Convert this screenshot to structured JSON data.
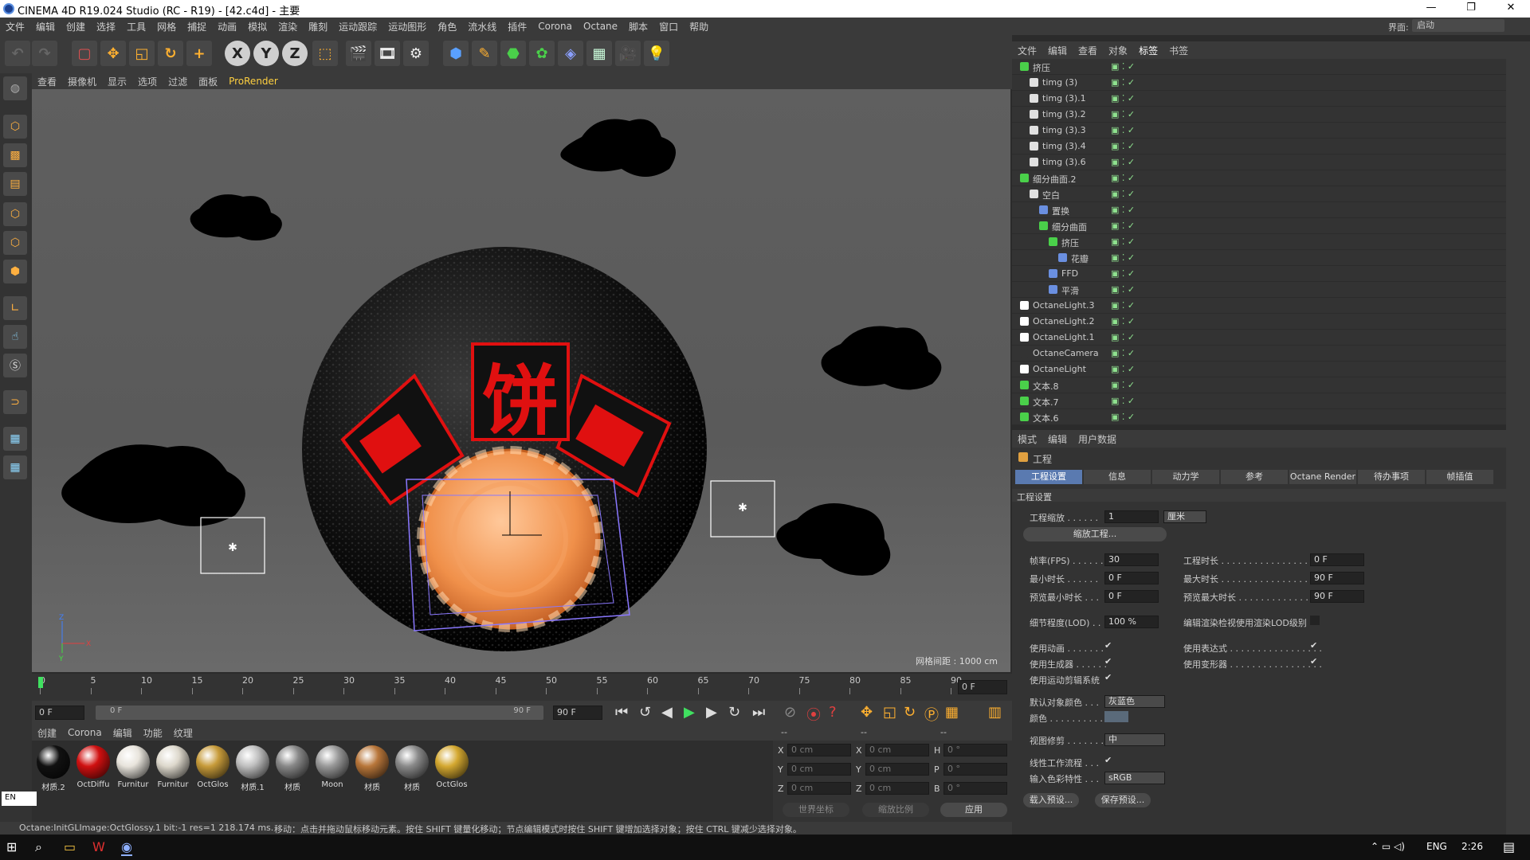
{
  "window": {
    "title": "CINEMA 4D R19.024 Studio (RC - R19) - [42.c4d] - 主要"
  },
  "menu": [
    "文件",
    "编辑",
    "创建",
    "选择",
    "工具",
    "网格",
    "捕捉",
    "动画",
    "模拟",
    "渲染",
    "雕刻",
    "运动跟踪",
    "运动图形",
    "角色",
    "流水线",
    "插件",
    "Corona",
    "Octane",
    "脚本",
    "窗口",
    "帮助"
  ],
  "layout": {
    "label": "界面:",
    "value": "启动"
  },
  "toolbar": {
    "axis": [
      "X",
      "Y",
      "Z"
    ]
  },
  "viewport": {
    "menu": [
      "查看",
      "摄像机",
      "显示",
      "选项",
      "过滤",
      "面板",
      "ProRender"
    ],
    "grid_label": "网格间距 : 1000 cm",
    "scene_chars": [
      "饼"
    ]
  },
  "timeline": {
    "ticks": [
      "0",
      "5",
      "10",
      "15",
      "20",
      "25",
      "30",
      "35",
      "40",
      "45",
      "50",
      "55",
      "60",
      "65",
      "70",
      "75",
      "80",
      "85",
      "90"
    ],
    "current": "0 F",
    "start": "0 F",
    "range_start": "0 F",
    "range_end": "90 F",
    "end": "90 F"
  },
  "materials": {
    "menu": [
      "创建",
      "Corona",
      "编辑",
      "功能",
      "纹理"
    ],
    "items": [
      {
        "name": "材质.2",
        "color": "#111"
      },
      {
        "name": "OctDiffu",
        "color": "#d01010"
      },
      {
        "name": "Furnitur",
        "color": "#e8e4dc"
      },
      {
        "name": "Furnitur",
        "color": "#ddd8cc"
      },
      {
        "name": "OctGlos",
        "color": "#c79b3a"
      },
      {
        "name": "材质.1",
        "color": "#bfbfbf"
      },
      {
        "name": "材质",
        "color": "#888"
      },
      {
        "name": "Moon",
        "color": "#999"
      },
      {
        "name": "材质",
        "color": "#b8763a"
      },
      {
        "name": "材质",
        "color": "#8a8a8a"
      },
      {
        "name": "OctGlos",
        "color": "#d4a830"
      }
    ]
  },
  "coords": {
    "headers": [
      "--",
      "--",
      "--"
    ],
    "rows": [
      [
        "X",
        "0 cm",
        "X",
        "0 cm",
        "H",
        "0 °"
      ],
      [
        "Y",
        "0 cm",
        "Y",
        "0 cm",
        "P",
        "0 °"
      ],
      [
        "Z",
        "0 cm",
        "Z",
        "0 cm",
        "B",
        "0 °"
      ]
    ],
    "world": "世界坐标",
    "scale": "缩放比例",
    "apply": "应用"
  },
  "status": {
    "left": "Octane:InitGLImage:OctGlossy.1  bit:-1 res=1  218.174 ms.",
    "right": "移动：点击并拖动鼠标移动元素。按住 SHIFT 键量化移动；节点编辑模式时按住 SHIFT 键增加选择对象；按住 CTRL 键减少选择对象。"
  },
  "objmgr": {
    "menu": [
      "文件",
      "编辑",
      "查看",
      "对象",
      "标签",
      "书签"
    ],
    "rows": [
      {
        "name": "挤压",
        "indent": 0,
        "icon": "#4ad04a"
      },
      {
        "name": "timg (3)",
        "indent": 1,
        "icon": "#e0e0e0"
      },
      {
        "name": "timg (3).1",
        "indent": 1,
        "icon": "#e0e0e0"
      },
      {
        "name": "timg (3).2",
        "indent": 1,
        "icon": "#e0e0e0"
      },
      {
        "name": "timg (3).3",
        "indent": 1,
        "icon": "#e0e0e0"
      },
      {
        "name": "timg (3).4",
        "indent": 1,
        "icon": "#e0e0e0"
      },
      {
        "name": "timg (3).6",
        "indent": 1,
        "icon": "#e0e0e0"
      },
      {
        "name": "细分曲面.2",
        "indent": 0,
        "icon": "#4ad04a"
      },
      {
        "name": "空白",
        "indent": 1,
        "icon": "#e0e0e0"
      },
      {
        "name": "置换",
        "indent": 2,
        "icon": "#6a8fe0"
      },
      {
        "name": "细分曲面",
        "indent": 2,
        "icon": "#4ad04a"
      },
      {
        "name": "挤压",
        "indent": 3,
        "icon": "#4ad04a"
      },
      {
        "name": "花瓣",
        "indent": 4,
        "icon": "#6a8fe0"
      },
      {
        "name": "FFD",
        "indent": 3,
        "icon": "#6a8fe0"
      },
      {
        "name": "平滑",
        "indent": 3,
        "icon": "#6a8fe0"
      },
      {
        "name": "OctaneLight.3",
        "indent": 0,
        "icon": "#fff"
      },
      {
        "name": "OctaneLight.2",
        "indent": 0,
        "icon": "#fff"
      },
      {
        "name": "OctaneLight.1",
        "indent": 0,
        "icon": "#fff"
      },
      {
        "name": "OctaneCamera",
        "indent": 0,
        "icon": "#333"
      },
      {
        "name": "OctaneLight",
        "indent": 0,
        "icon": "#fff"
      },
      {
        "name": "文本.8",
        "indent": 0,
        "icon": "#4ad04a"
      },
      {
        "name": "文本.7",
        "indent": 0,
        "icon": "#4ad04a"
      },
      {
        "name": "文本.6",
        "indent": 0,
        "icon": "#4ad04a"
      }
    ]
  },
  "attr": {
    "menu": [
      "模式",
      "编辑",
      "用户数据"
    ],
    "title": "工程",
    "tabs": [
      "工程设置",
      "信息",
      "动力学",
      "参考",
      "Octane Render",
      "待办事项",
      "帧插值"
    ],
    "section": "工程设置",
    "scale_label": "工程缩放 . . . . . .",
    "scale_value": "1",
    "scale_unit": "厘米",
    "scale_btn": "缩放工程...",
    "fps_label": "帧率(FPS) . . . . . .",
    "fps": "30",
    "dur_label": "工程时长 . . . . . . . . . . . . . . . . . . .",
    "dur": "0 F",
    "min_label": "最小时长 . . . . . .",
    "min": "0 F",
    "max_label": "最大时长 . . . . . . . . . . . . . . . . . . .",
    "max": "90 F",
    "pmin_label": "预览最小时长 . . .",
    "pmin": "0 F",
    "pmax_label": "预览最大时长 . . . . . . . . . . . . . . . .",
    "pmax": "90 F",
    "lod_label": "细节程度(LOD) . .",
    "lod": "100 %",
    "lod2_label": "编辑渲染检视使用渲染LOD级别",
    "anim_label": "使用动画 . . . . . . .",
    "expr_label": "使用表达式 . . . . . . . . . . . . . . . . .",
    "gen_label": "使用生成器 . . . . . .",
    "def_label": "使用变形器 . . . . . . . . . . . . . . . . .",
    "mo_label": "使用运动剪辑系统",
    "objcol_label": "默认对象颜色 . . .",
    "objcol": "灰蓝色",
    "col_label": "颜色 . . . . . . . . . .",
    "clip_label": "视图修剪 . . . . . . .",
    "clip": "中",
    "linear_label": "线性工作流程 . . .",
    "input_label": "输入色彩特性 . . .",
    "input": "sRGB",
    "load_btn": "载入预设...",
    "save_btn": "保存预设..."
  },
  "taskbar": {
    "lang": "ENG",
    "time": "2:26"
  },
  "ime": "EN"
}
